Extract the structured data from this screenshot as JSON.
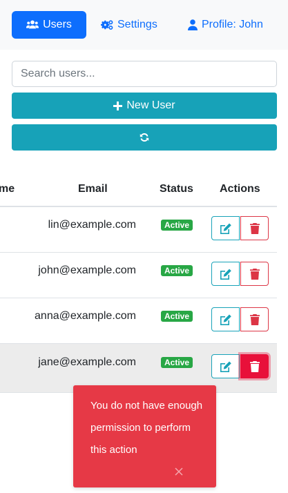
{
  "nav": {
    "users_label": "Users",
    "settings_label": "Settings",
    "profile_label": "Profile: John"
  },
  "search": {
    "placeholder": "Search users...",
    "value": ""
  },
  "actions": {
    "new_user_label": "New User"
  },
  "table": {
    "headers": {
      "name_partial": "me",
      "email": "Email",
      "status": "Status",
      "actions": "Actions"
    },
    "rows": [
      {
        "email": "lin@example.com",
        "status": "Active"
      },
      {
        "email": "john@example.com",
        "status": "Active"
      },
      {
        "email": "anna@example.com",
        "status": "Active"
      },
      {
        "email": "jane@example.com",
        "status": "Active"
      }
    ]
  },
  "toast": {
    "message": "You do not have enough permission to perform this action"
  },
  "colors": {
    "primary": "#0d6efd",
    "info": "#17a2b8",
    "success": "#28a745",
    "danger": "#dc3545",
    "toast": "#e63946"
  },
  "icons": [
    "users-icon",
    "gears-icon",
    "user-icon",
    "plus-icon",
    "sync-icon",
    "edit-icon",
    "trash-icon",
    "close-icon"
  ]
}
